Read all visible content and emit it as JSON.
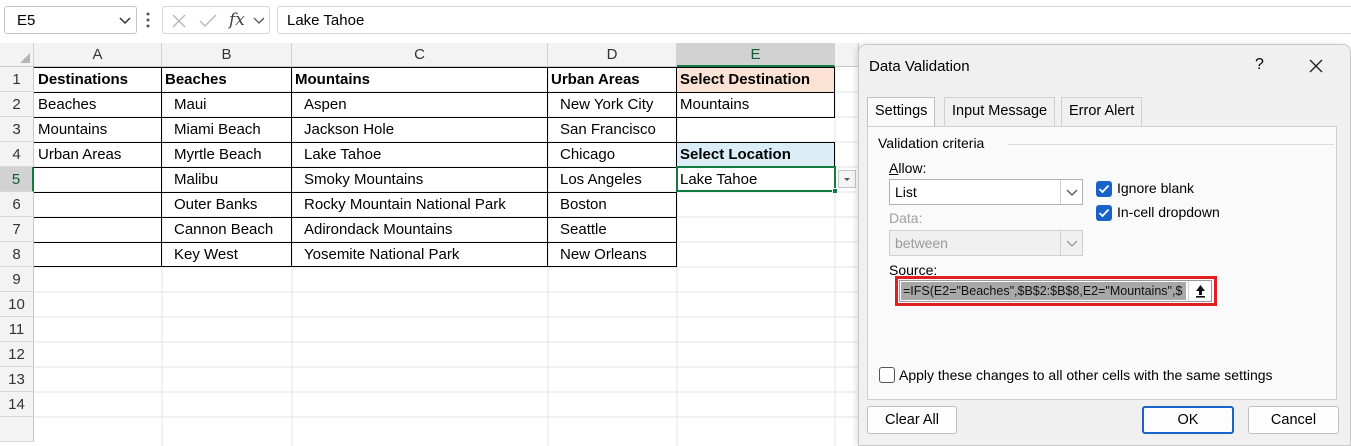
{
  "formula_bar": {
    "name_box": "E5",
    "fx": "fx",
    "formula": "Lake Tahoe"
  },
  "columns": [
    "A",
    "B",
    "C",
    "D",
    "E"
  ],
  "rows": [
    "1",
    "2",
    "3",
    "4",
    "5",
    "6",
    "7",
    "8",
    "9",
    "10",
    "11",
    "12",
    "13",
    "14"
  ],
  "cells": {
    "A1": "Destinations",
    "B1": "Beaches",
    "C1": "Mountains",
    "D1": "Urban Areas",
    "E1": "Select Destination",
    "A2": "Beaches",
    "B2": "Maui",
    "C2": "Aspen",
    "D2": "New York City",
    "E2": "Mountains",
    "A3": "Mountains",
    "B3": "Miami Beach",
    "C3": "Jackson Hole",
    "D3": "San Francisco",
    "A4": "Urban Areas",
    "B4": "Myrtle Beach",
    "C4": "Lake Tahoe",
    "D4": "Chicago",
    "E4": "Select Location",
    "B5": "Malibu",
    "C5": "Smoky Mountains",
    "D5": "Los Angeles",
    "E5": "Lake Tahoe",
    "B6": "Outer Banks",
    "C6": "Rocky Mountain National Park",
    "D6": "Boston",
    "B7": "Cannon Beach",
    "C7": "Adirondack Mountains",
    "D7": "Seattle",
    "B8": "Key West",
    "C8": "Yosemite National Park",
    "D8": "New Orleans"
  },
  "colors": {
    "e1_fill": "#fbe2d5",
    "e4_fill": "#dbeef7",
    "selection": "#107c41",
    "checkbox": "#1a62c8",
    "highlight_box": "#e02020"
  },
  "dialog": {
    "title": "Data Validation",
    "help": "?",
    "tabs": [
      "Settings",
      "Input Message",
      "Error Alert"
    ],
    "section": "Validation criteria",
    "allow_label": "Allow:",
    "allow_value": "List",
    "data_label": "Data:",
    "data_value": "between",
    "ignore_blank": "Ignore blank",
    "in_cell_dropdown": "In-cell dropdown",
    "source_label": "Source:",
    "source_value": "=IFS(E2=\"Beaches\",$B$2:$B$8,E2=\"Mountains\",$",
    "apply_all": "Apply these changes to all other cells with the same settings",
    "clear_all": "Clear All",
    "ok": "OK",
    "cancel": "Cancel"
  }
}
